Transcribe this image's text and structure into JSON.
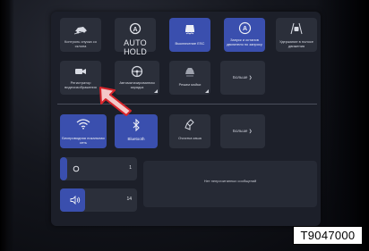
{
  "quick_toggles": [
    {
      "label": "Контроль спуска со склона",
      "icon": "car-descent-icon",
      "active": false
    },
    {
      "label": "AUTO HOLD",
      "icon": "auto-hold-icon",
      "active": false
    },
    {
      "label": "Выключение ESC",
      "icon": "esc-off-icon",
      "active": true
    },
    {
      "label": "Запуск и останов двигателя по запросу",
      "icon": "auto-start-stop-icon",
      "active": true
    },
    {
      "label": "Удержание в полосе движения",
      "icon": "lane-keep-icon",
      "active": false
    }
  ],
  "second_row": [
    {
      "label": "Регистратор видеоизображения",
      "icon": "camera-icon",
      "active": false
    },
    {
      "label": "Автоматизированная зарядка",
      "icon": "steering-wheel-icon",
      "active": false
    },
    {
      "label": "Режим мойки",
      "icon": "car-wash-icon",
      "active": false
    }
  ],
  "more_label_1": "Больше ❯",
  "connectivity": [
    {
      "label": "Беспроводная локальная сеть",
      "icon": "wifi-icon",
      "active": true
    },
    {
      "label": "Bluetooth",
      "icon": "bluetooth-icon",
      "active": true
    },
    {
      "label": "Очистка кэша",
      "icon": "brush-icon",
      "active": false
    }
  ],
  "more_label_2": "Больше ❯",
  "brightness": {
    "value": "1",
    "level": 0.06,
    "icon": "brightness-icon"
  },
  "volume": {
    "value": "14",
    "level": 0.15,
    "icon": "volume-icon"
  },
  "notifications": {
    "text": "Нет непрочитанных сообщений"
  },
  "figure_code": "T9047000"
}
